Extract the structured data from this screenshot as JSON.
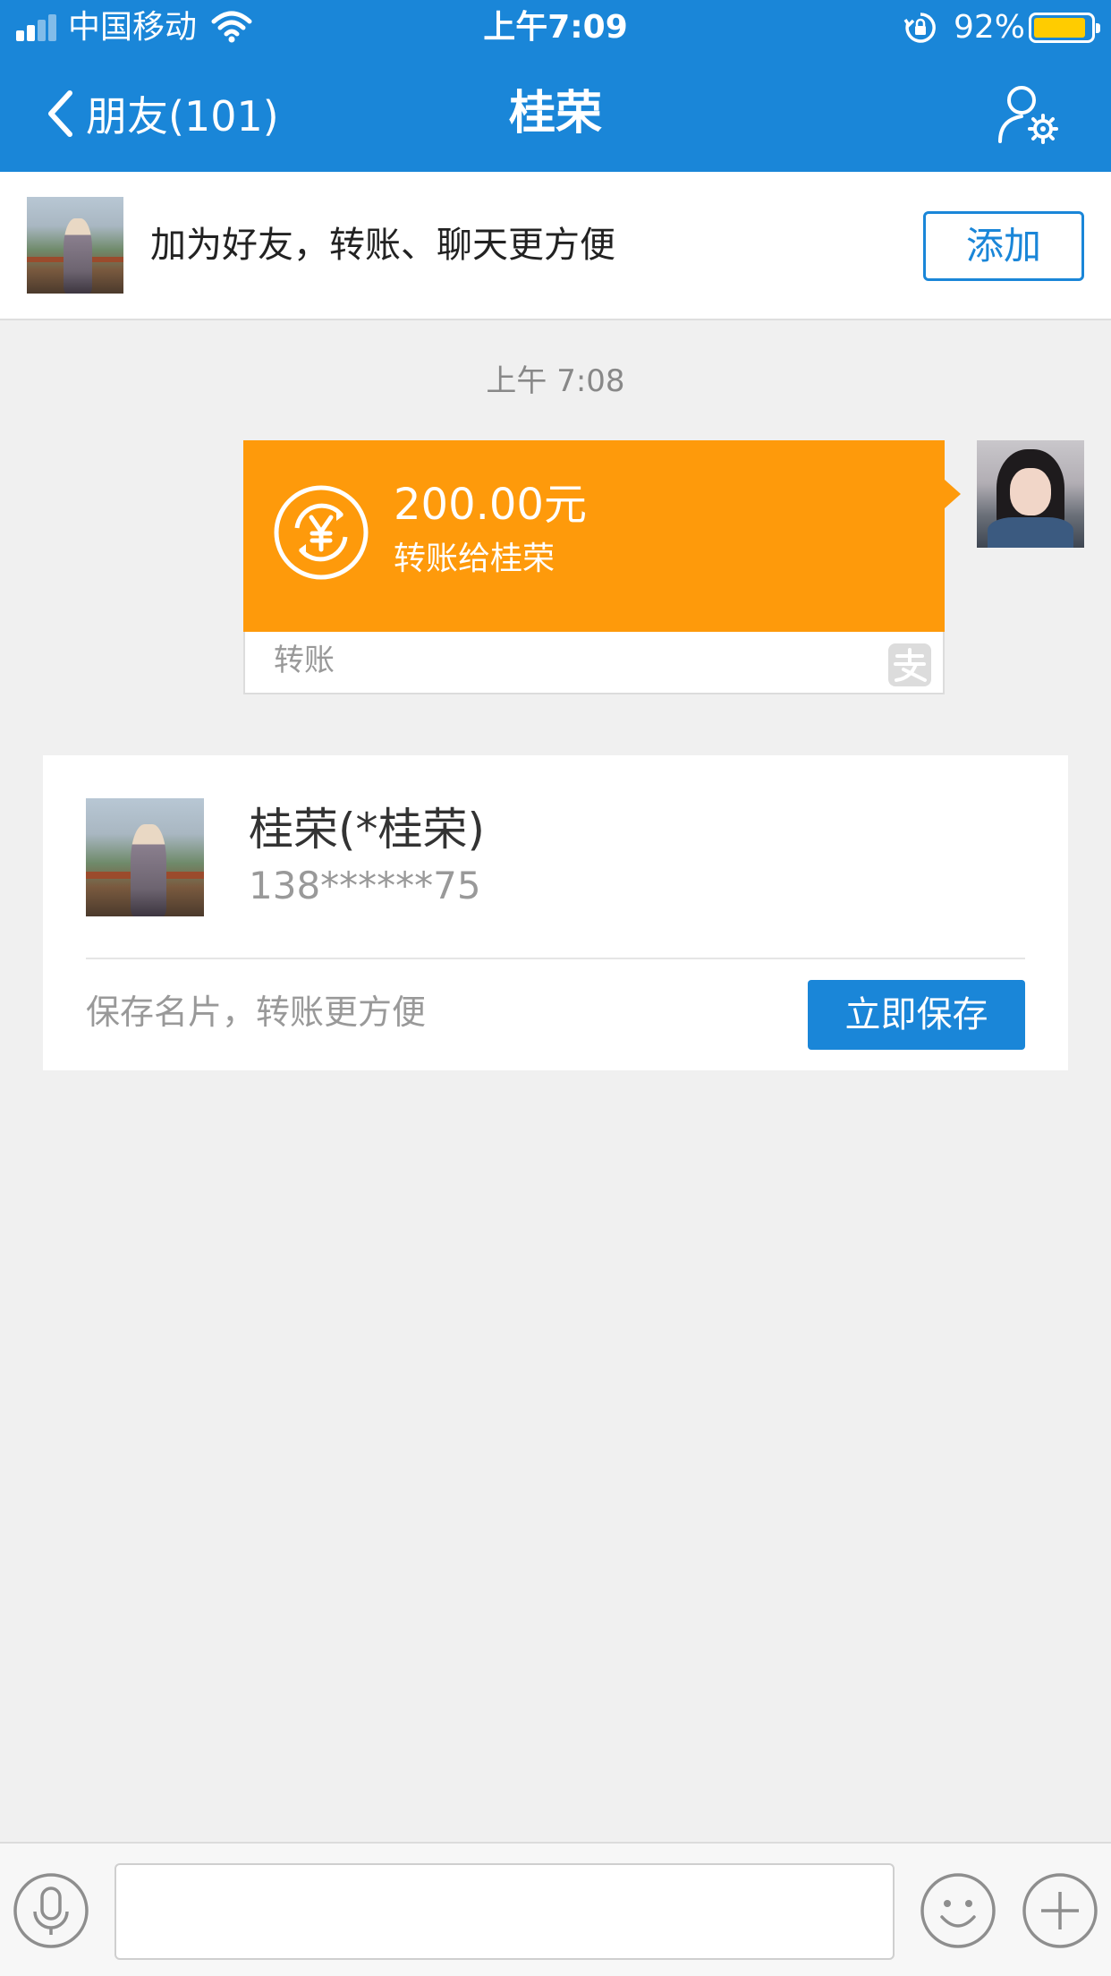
{
  "status_bar": {
    "carrier": "中国移动",
    "time": "上午7:09",
    "battery_percent": "92%",
    "battery_level": 0.92,
    "battery_color": "#ffcc00"
  },
  "nav": {
    "back_label": "朋友(101)",
    "title": "桂荣",
    "accent_color": "#1a86d8"
  },
  "add_banner": {
    "text": "加为好友，转账、聊天更方便",
    "button_label": "添加"
  },
  "chat": {
    "timestamp": "上午 7:08",
    "transfer": {
      "amount": "200.00元",
      "description": "转账给桂荣",
      "label": "转账",
      "card_color": "#fe9a0b"
    }
  },
  "contact_card": {
    "name": "桂荣(*桂荣)",
    "phone": "138******75",
    "hint": "保存名片，转账更方便",
    "save_button": "立即保存"
  },
  "input_bar": {
    "placeholder": "",
    "icons": [
      "microphone-icon",
      "emoji-icon",
      "plus-icon"
    ]
  }
}
